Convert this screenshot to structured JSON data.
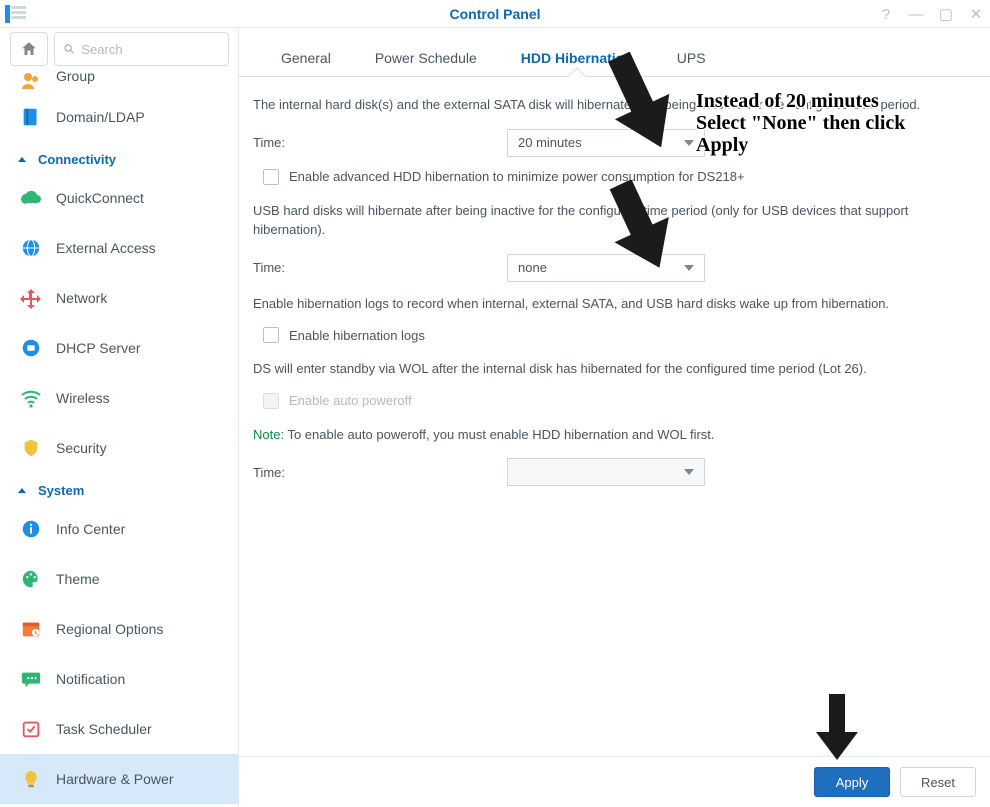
{
  "window": {
    "title": "Control Panel"
  },
  "search": {
    "placeholder": "Search"
  },
  "sidebar": {
    "partial_item_label": "Group",
    "items_top": [
      {
        "label": "Domain/LDAP"
      }
    ],
    "sections": [
      {
        "title": "Connectivity",
        "items": [
          {
            "label": "QuickConnect"
          },
          {
            "label": "External Access"
          },
          {
            "label": "Network"
          },
          {
            "label": "DHCP Server"
          },
          {
            "label": "Wireless"
          },
          {
            "label": "Security"
          }
        ]
      },
      {
        "title": "System",
        "items": [
          {
            "label": "Info Center"
          },
          {
            "label": "Theme"
          },
          {
            "label": "Regional Options"
          },
          {
            "label": "Notification"
          },
          {
            "label": "Task Scheduler"
          },
          {
            "label": "Hardware & Power"
          }
        ]
      }
    ]
  },
  "tabs": [
    {
      "label": "General"
    },
    {
      "label": "Power Schedule"
    },
    {
      "label": "HDD Hibernation"
    },
    {
      "label": "UPS"
    }
  ],
  "pane": {
    "p1": "The internal hard disk(s) and the external SATA disk will hibernate after being inactive for the configured time period.",
    "time_label": "Time:",
    "time1_value": "20 minutes",
    "advanced_hdd": "Enable advanced HDD hibernation to minimize power consumption for DS218+",
    "p2": "USB hard disks will hibernate after being inactive for the configured time period (only for USB devices that support hibernation).",
    "time2_value": "none",
    "p3": "Enable hibernation logs to record when internal, external SATA, and USB hard disks wake up from hibernation.",
    "hib_logs": "Enable hibernation logs",
    "p4": "DS will enter standby via WOL after the internal disk has hibernated for the configured time period (Lot 26).",
    "auto_poweroff": "Enable auto poweroff",
    "note_word": "Note:",
    "note_rest": " To enable auto poweroff, you must enable HDD hibernation and WOL first.",
    "time3_value": ""
  },
  "footer": {
    "apply": "Apply",
    "reset": "Reset"
  },
  "annotation": {
    "line1": "Instead of 20 minutes",
    "line2": "Select \"None\" then click",
    "line3": "Apply"
  }
}
